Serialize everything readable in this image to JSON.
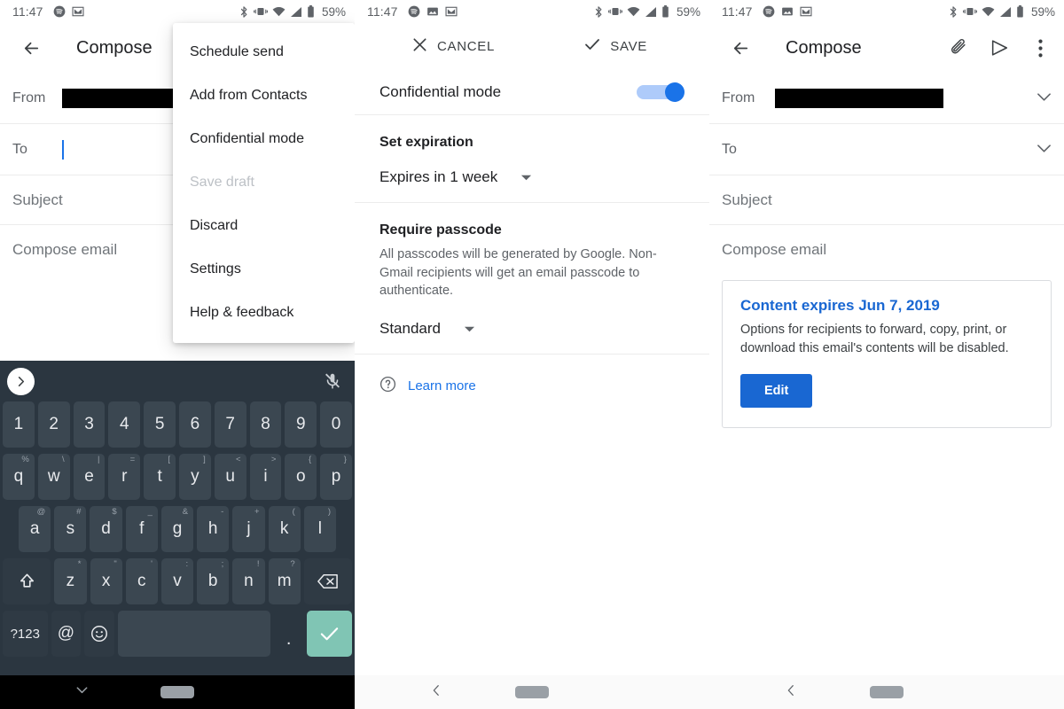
{
  "status_bar": {
    "time": "11:47",
    "battery": "59%",
    "left_icons": [
      "spotify-icon",
      "gmail-icon"
    ],
    "left_icons_with_image": [
      "spotify-icon",
      "image-icon",
      "gmail-icon"
    ],
    "right_icons": [
      "bluetooth-icon",
      "vibrate-icon",
      "wifi-icon",
      "cell-signal-icon",
      "battery-icon"
    ]
  },
  "panel1": {
    "appbar": {
      "back": "back-arrow",
      "title": "Compose"
    },
    "fields": {
      "from_label": "From",
      "from_value": "",
      "to_label": "To",
      "to_value": "",
      "subject_placeholder": "Subject",
      "body_placeholder": "Compose email"
    },
    "menu": {
      "items": [
        {
          "label": "Schedule send",
          "disabled": false
        },
        {
          "label": "Add from Contacts",
          "disabled": false
        },
        {
          "label": "Confidential mode",
          "disabled": false
        },
        {
          "label": "Save draft",
          "disabled": true
        },
        {
          "label": "Discard",
          "disabled": false
        },
        {
          "label": "Settings",
          "disabled": false
        },
        {
          "label": "Help & feedback",
          "disabled": false
        }
      ]
    },
    "keyboard": {
      "numbers": [
        "1",
        "2",
        "3",
        "4",
        "5",
        "6",
        "7",
        "8",
        "9",
        "0"
      ],
      "row1": [
        {
          "k": "q",
          "s": "%"
        },
        {
          "k": "w",
          "s": "\\"
        },
        {
          "k": "e",
          "s": "|"
        },
        {
          "k": "r",
          "s": "="
        },
        {
          "k": "t",
          "s": "["
        },
        {
          "k": "y",
          "s": "]"
        },
        {
          "k": "u",
          "s": "<"
        },
        {
          "k": "i",
          "s": ">"
        },
        {
          "k": "o",
          "s": "{"
        },
        {
          "k": "p",
          "s": "}"
        }
      ],
      "row2": [
        {
          "k": "a",
          "s": "@"
        },
        {
          "k": "s",
          "s": "#"
        },
        {
          "k": "d",
          "s": "$"
        },
        {
          "k": "f",
          "s": "_"
        },
        {
          "k": "g",
          "s": "&"
        },
        {
          "k": "h",
          "s": "-"
        },
        {
          "k": "j",
          "s": "+"
        },
        {
          "k": "k",
          "s": "("
        },
        {
          "k": "l",
          "s": ")"
        }
      ],
      "row3": [
        {
          "k": "z",
          "s": "*"
        },
        {
          "k": "x",
          "s": "\""
        },
        {
          "k": "c",
          "s": "'"
        },
        {
          "k": "v",
          "s": ":"
        },
        {
          "k": "b",
          "s": ";"
        },
        {
          "k": "n",
          "s": "!"
        },
        {
          "k": "m",
          "s": "?"
        }
      ],
      "shift": "shift-key",
      "backspace": "backspace-key",
      "symbols": "?123",
      "at": "@",
      "emoji": "emoji-key",
      "space": "",
      "period": ".",
      "enter": "enter-key",
      "expand": "expand-toolbar",
      "mic": "mic-muted-icon",
      "enter_color": "#80c5b4",
      "bg_color": "#2b3640",
      "key_color": "#3b4751"
    },
    "navbar": {
      "dismiss": "keyboard-down-icon",
      "pill": "home-pill",
      "dark": true
    }
  },
  "panel2": {
    "appbar": {
      "cancel": "CANCEL",
      "save": "SAVE"
    },
    "confidential_mode": {
      "label": "Confidential mode",
      "enabled": true
    },
    "set_expiration": {
      "heading": "Set expiration",
      "selected": "Expires in 1 week"
    },
    "require_passcode": {
      "heading": "Require passcode",
      "description": "All passcodes will be generated by Google. Non-Gmail recipients will get an email passcode to authenticate.",
      "selected": "Standard"
    },
    "learn_more": {
      "label": "Learn more",
      "icon": "help-circle-icon"
    },
    "navbar": {
      "back": "back-chevron",
      "pill": "home-pill",
      "dark": false
    },
    "accent_color": "#1a73e8"
  },
  "panel3": {
    "appbar": {
      "back": "back-arrow",
      "title": "Compose",
      "attach": "attach-icon",
      "send": "send-icon",
      "more": "more-vert-icon"
    },
    "fields": {
      "from_label": "From",
      "from_value": "",
      "to_label": "To",
      "to_value": "",
      "subject_placeholder": "Subject",
      "body_placeholder": "Compose email"
    },
    "expiry_card": {
      "title": "Content expires Jun 7, 2019",
      "description": "Options for recipients to forward, copy, print, or download this email's contents will be disabled.",
      "button": "Edit",
      "title_color": "#1967d2",
      "button_color": "#1967d2"
    },
    "navbar": {
      "back": "back-chevron",
      "pill": "home-pill",
      "dark": false
    }
  }
}
